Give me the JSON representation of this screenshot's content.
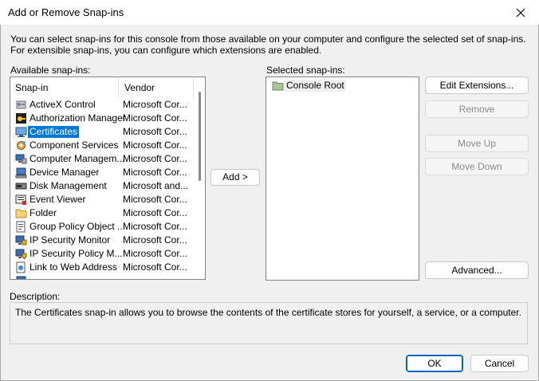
{
  "window": {
    "title": "Add or Remove Snap-ins"
  },
  "intro_text": "You can select snap-ins for this console from those available on your computer and configure the selected set of snap-ins. For extensible snap-ins, you can configure which extensions are enabled.",
  "available": {
    "label": "Available snap-ins:",
    "columns": [
      "Snap-in",
      "Vendor"
    ],
    "rows": [
      {
        "name": "ActiveX Control",
        "vendor": "Microsoft Cor...",
        "icon": "activex-icon"
      },
      {
        "name": "Authorization Manager",
        "vendor": "Microsoft Cor...",
        "icon": "authorization-icon"
      },
      {
        "name": "Certificates",
        "vendor": "Microsoft Cor...",
        "icon": "certificates-icon",
        "selected": true
      },
      {
        "name": "Component Services",
        "vendor": "Microsoft Cor...",
        "icon": "component-services-icon"
      },
      {
        "name": "Computer Managem...",
        "vendor": "Microsoft Cor...",
        "icon": "computer-management-icon"
      },
      {
        "name": "Device Manager",
        "vendor": "Microsoft Cor...",
        "icon": "device-manager-icon"
      },
      {
        "name": "Disk Management",
        "vendor": "Microsoft and...",
        "icon": "disk-management-icon"
      },
      {
        "name": "Event Viewer",
        "vendor": "Microsoft Cor...",
        "icon": "event-viewer-icon"
      },
      {
        "name": "Folder",
        "vendor": "Microsoft Cor...",
        "icon": "folder-icon"
      },
      {
        "name": "Group Policy Object ...",
        "vendor": "Microsoft Cor...",
        "icon": "group-policy-icon"
      },
      {
        "name": "IP Security Monitor",
        "vendor": "Microsoft Cor...",
        "icon": "ip-security-monitor-icon"
      },
      {
        "name": "IP Security Policy M...",
        "vendor": "Microsoft Cor...",
        "icon": "ip-security-policy-icon"
      },
      {
        "name": "Link to Web Address",
        "vendor": "Microsoft Cor...",
        "icon": "link-web-icon"
      }
    ]
  },
  "buttons": {
    "add": "Add >",
    "edit_extensions": "Edit Extensions...",
    "remove": "Remove",
    "move_up": "Move Up",
    "move_down": "Move Down",
    "advanced": "Advanced...",
    "ok": "OK",
    "cancel": "Cancel"
  },
  "selected": {
    "label": "Selected snap-ins:",
    "items": [
      {
        "name": "Console Root",
        "icon": "folder-icon"
      }
    ]
  },
  "description": {
    "label": "Description:",
    "text": "The Certificates snap-in allows you to browse the contents of the certificate stores for yourself, a service, or a computer."
  },
  "colors": {
    "selection": "#0078d7",
    "default_button_border": "#0067c0"
  }
}
